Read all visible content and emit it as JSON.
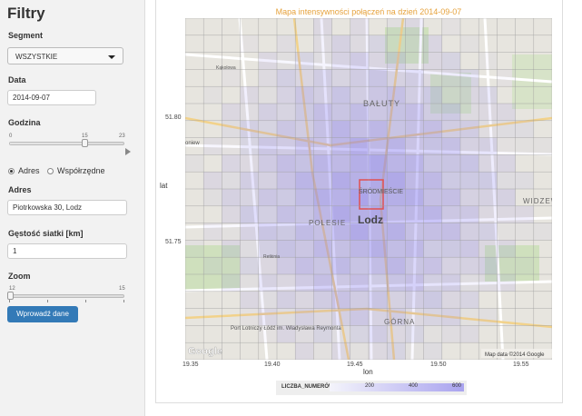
{
  "sidebar": {
    "title": "Filtry",
    "segment": {
      "label": "Segment",
      "value": "WSZYSTKIE"
    },
    "date": {
      "label": "Data",
      "value": "2014-09-07"
    },
    "hour": {
      "label": "Godzina",
      "min": "0",
      "value": "15",
      "max": "23",
      "fraction": 0.652
    },
    "location_mode": {
      "options": [
        "Adres",
        "Współrzędne"
      ],
      "selected": "Adres"
    },
    "address": {
      "label": "Adres",
      "value": "Piotrkowska 30, Lodz"
    },
    "grid": {
      "label": "Gęstość siatki [km]",
      "value": "1"
    },
    "zoom": {
      "label": "Zoom",
      "min": "12",
      "max": "15",
      "value": 12
    },
    "submit_label": "Wprowadź dane"
  },
  "plot": {
    "title": "Mapa intensywności połączeń na dzień 2014-09-07",
    "x_label": "lon",
    "y_label": "lat",
    "x_ticks": [
      "19.35",
      "19.40",
      "19.45",
      "19.50",
      "19.55"
    ],
    "y_ticks": [
      "51.80",
      "51.75"
    ],
    "attribution": "Map data ©2014 Google",
    "google": "Google",
    "place_names": [
      "BAŁUTY",
      "ŚRÓDMIEŚCIE",
      "POLESIE",
      "Lodz",
      "WIDZEW",
      "GÓRNA",
      "Port Lotniczy Łódź im. Władysława Reymonta",
      "oniew",
      "Kąkolowa",
      "Retkinia"
    ],
    "legend": {
      "title": "LICZBA_NUMERÓW",
      "ticks": [
        "200",
        "400",
        "600"
      ]
    }
  },
  "colors": {
    "accent": "#337ab7",
    "title": "#e6a23c",
    "cell": "#7b6ff0",
    "highlight": "#e05050"
  }
}
